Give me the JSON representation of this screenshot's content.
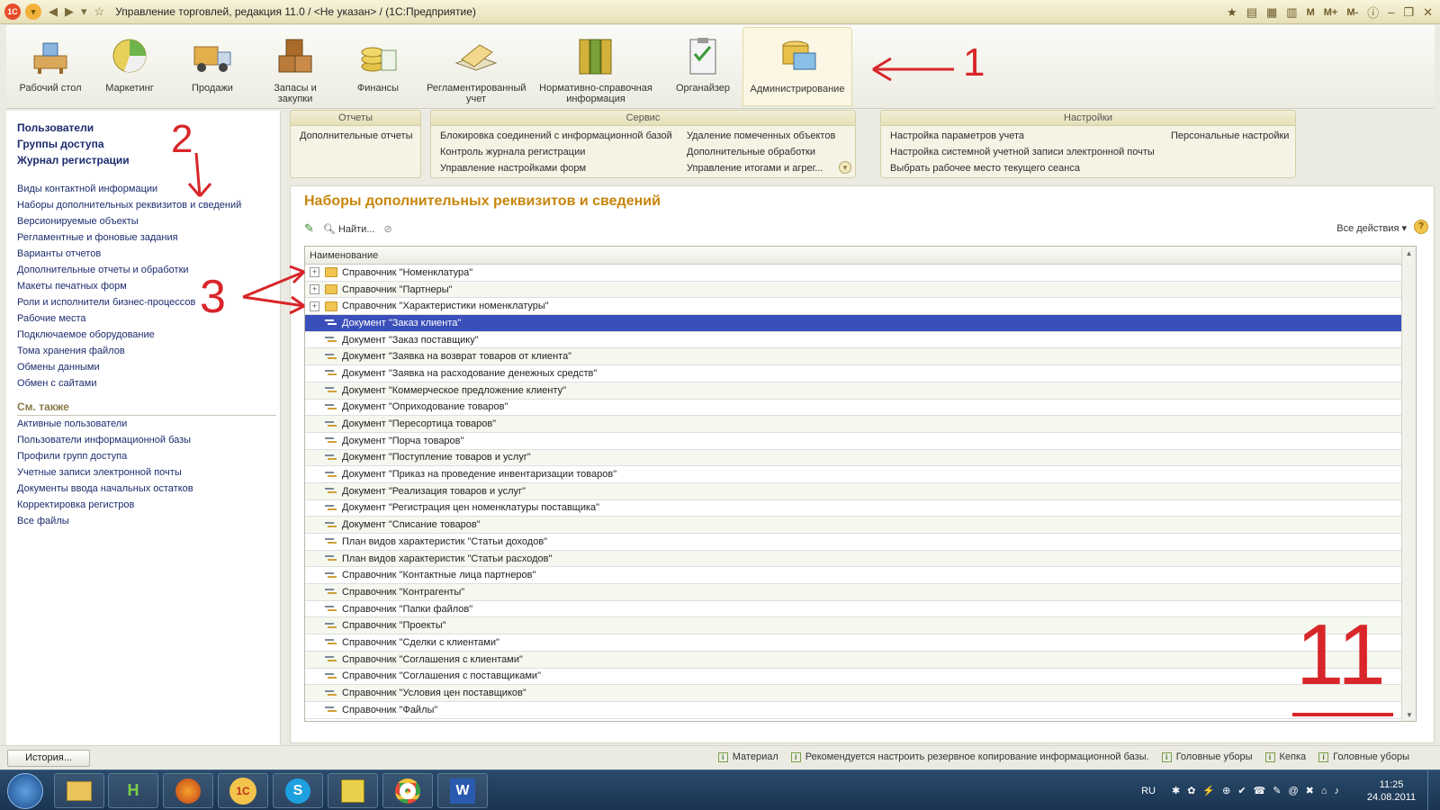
{
  "window": {
    "title": "Управление торговлей, редакция 11.0 / <Не указан> / (1С:Предприятие)",
    "logo": "1C",
    "right_buttons": [
      "M",
      "M+",
      "M-"
    ]
  },
  "sections": [
    {
      "label": "Рабочий стол",
      "icon": "desk-icon",
      "active": false
    },
    {
      "label": "Маркетинг",
      "icon": "pie-chart-icon",
      "active": false
    },
    {
      "label": "Продажи",
      "icon": "truck-icon",
      "active": false
    },
    {
      "label": "Запасы и закупки",
      "icon": "boxes-icon",
      "active": false
    },
    {
      "label": "Финансы",
      "icon": "coins-icon",
      "active": false
    },
    {
      "label": "Регламентированный учет",
      "icon": "ledger-icon",
      "active": false
    },
    {
      "label": "Нормативно-справочная информация",
      "icon": "binders-icon",
      "active": false
    },
    {
      "label": "Органайзер",
      "icon": "clipboard-icon",
      "active": false
    },
    {
      "label": "Администрирование",
      "icon": "admin-icon",
      "active": true
    }
  ],
  "left_panel": {
    "main_links": [
      "Пользователи",
      "Группы доступа",
      "Журнал регистрации"
    ],
    "links": [
      "Виды контактной информации",
      "Наборы дополнительных реквизитов и сведений",
      "Версионируемые объекты",
      "Регламентные и фоновые задания",
      "Варианты отчетов",
      "Дополнительные отчеты и обработки",
      "Макеты печатных форм",
      "Роли и исполнители бизнес-процессов",
      "Рабочие места",
      "Подключаемое оборудование",
      "Тома хранения файлов",
      "Обмены данными",
      "Обмен с сайтами"
    ],
    "see_also_title": "См. также",
    "see_also": [
      "Активные пользователи",
      "Пользователи информационной базы",
      "Профили групп доступа",
      "Учетные записи электронной почты",
      "Документы ввода начальных остатков",
      "Корректировка регистров",
      "Все файлы"
    ]
  },
  "command_bar": {
    "reports": {
      "title": "Отчеты",
      "items": [
        "Дополнительные отчеты"
      ]
    },
    "service": {
      "title": "Сервис",
      "col1": [
        "Блокировка соединений с информационной базой",
        "Контроль журнала регистрации",
        "Управление настройками форм"
      ],
      "col2": [
        "Удаление помеченных объектов",
        "Дополнительные обработки",
        "Управление итогами и агрег..."
      ]
    },
    "settings": {
      "title": "Настройки",
      "col1": [
        "Настройка параметров учета",
        "Настройка системной учетной записи электронной почты",
        "Выбрать рабочее место текущего сеанса"
      ],
      "col2": [
        "Персональные настройки"
      ]
    }
  },
  "form": {
    "title": "Наборы дополнительных реквизитов и сведений",
    "find_label": "Найти...",
    "all_actions": "Все действия",
    "help": "?",
    "column_header": "Наименование",
    "rows": [
      {
        "text": "Справочник \"Номенклатура\"",
        "type": "folder",
        "selected": false
      },
      {
        "text": "Справочник \"Партнеры\"",
        "type": "folder",
        "selected": false
      },
      {
        "text": "Справочник \"Характеристики номенклатуры\"",
        "type": "folder",
        "selected": false
      },
      {
        "text": "Документ \"Заказ клиента\"",
        "type": "item",
        "selected": true
      },
      {
        "text": "Документ \"Заказ поставщику\"",
        "type": "item",
        "selected": false
      },
      {
        "text": "Документ \"Заявка на возврат товаров от клиента\"",
        "type": "item",
        "selected": false
      },
      {
        "text": "Документ \"Заявка на расходование денежных средств\"",
        "type": "item",
        "selected": false
      },
      {
        "text": "Документ \"Коммерческое предложение клиенту\"",
        "type": "item",
        "selected": false
      },
      {
        "text": "Документ \"Оприходование товаров\"",
        "type": "item",
        "selected": false
      },
      {
        "text": "Документ \"Пересортица товаров\"",
        "type": "item",
        "selected": false
      },
      {
        "text": "Документ \"Порча товаров\"",
        "type": "item",
        "selected": false
      },
      {
        "text": "Документ \"Поступление товаров и услуг\"",
        "type": "item",
        "selected": false
      },
      {
        "text": "Документ \"Приказ на проведение инвентаризации товаров\"",
        "type": "item",
        "selected": false
      },
      {
        "text": "Документ \"Реализация товаров и услуг\"",
        "type": "item",
        "selected": false
      },
      {
        "text": "Документ \"Регистрация цен номенклатуры поставщика\"",
        "type": "item",
        "selected": false
      },
      {
        "text": "Документ \"Списание товаров\"",
        "type": "item",
        "selected": false
      },
      {
        "text": "План видов характеристик \"Статьи доходов\"",
        "type": "item",
        "selected": false
      },
      {
        "text": "План видов характеристик \"Статьи расходов\"",
        "type": "item",
        "selected": false
      },
      {
        "text": "Справочник \"Контактные лица партнеров\"",
        "type": "item",
        "selected": false
      },
      {
        "text": "Справочник \"Контрагенты\"",
        "type": "item",
        "selected": false
      },
      {
        "text": "Справочник \"Папки файлов\"",
        "type": "item",
        "selected": false
      },
      {
        "text": "Справочник \"Проекты\"",
        "type": "item",
        "selected": false
      },
      {
        "text": "Справочник \"Сделки с клиентами\"",
        "type": "item",
        "selected": false
      },
      {
        "text": "Справочник \"Соглашения с клиентами\"",
        "type": "item",
        "selected": false
      },
      {
        "text": "Справочник \"Соглашения с поставщиками\"",
        "type": "item",
        "selected": false
      },
      {
        "text": "Справочник \"Условия цен поставщиков\"",
        "type": "item",
        "selected": false
      },
      {
        "text": "Справочник \"Файлы\"",
        "type": "item",
        "selected": false
      }
    ]
  },
  "status_bar": {
    "history": "История...",
    "notes": [
      "Материал",
      "Рекомендуется настроить резервное копирование информационной базы.",
      "Головные уборы",
      "Кепка",
      "Головные уборы"
    ]
  },
  "taskbar": {
    "lang": "RU",
    "time": "11:25",
    "date": "24.08.2011",
    "apps": [
      "explorer",
      "H",
      "firefox",
      "1С",
      "skype",
      "1c-config",
      "chrome",
      "word"
    ]
  },
  "annotations": [
    "1",
    "2",
    "3",
    "11"
  ],
  "colors": {
    "accent": "#c8860b",
    "link": "#1c2c6e",
    "selection": "#3b4fba",
    "annotation": "#d8262a"
  }
}
